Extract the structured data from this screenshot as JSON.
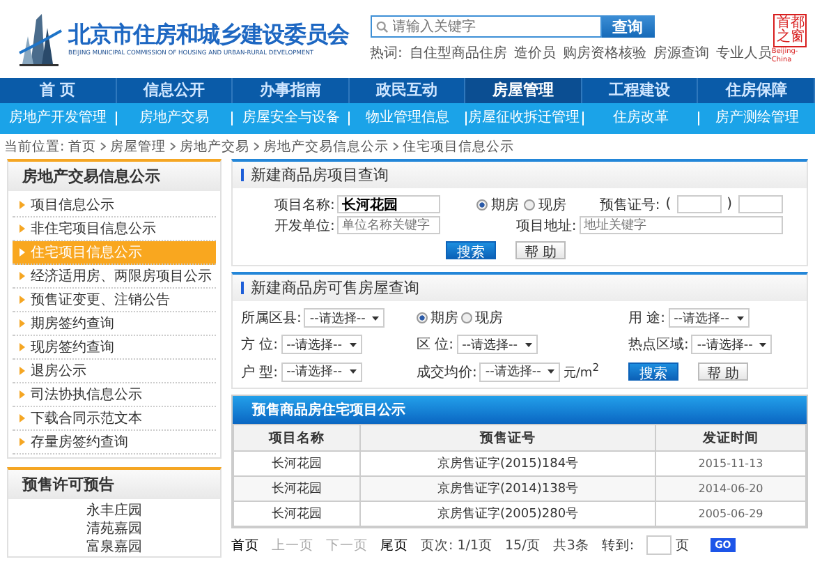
{
  "header": {
    "title": "北京市住房和城乡建设委员会",
    "subtitle": "BEIJING MUNICIPAL COMMISSION OF HOUSING AND URBAN-RURAL DEVELOPMENT",
    "search": {
      "placeholder": "请输入关键字"
    },
    "search_button": "查询",
    "hot_label": "热词:",
    "hot_words": [
      "自住型商品住房",
      "造价员",
      "购房资格核验",
      "房源查询",
      "专业人员"
    ],
    "seal": [
      "首都",
      "之窗"
    ],
    "seal_caption": "Beijing-China"
  },
  "nav": [
    {
      "label": "首 页",
      "selected": false
    },
    {
      "label": "信息公开",
      "selected": false
    },
    {
      "label": "办事指南",
      "selected": false
    },
    {
      "label": "政民互动",
      "selected": false
    },
    {
      "label": "房屋管理",
      "selected": true
    },
    {
      "label": "工程建设",
      "selected": false
    },
    {
      "label": "住房保障",
      "selected": false
    }
  ],
  "subnav": [
    "房地产开发管理",
    "房地产交易",
    "房屋安全与设备",
    "物业管理信息",
    "房屋征收拆迁管理",
    "住房改革",
    "房产测绘管理"
  ],
  "breadcrumb": {
    "label": "当前位置:",
    "items": [
      "首页",
      "房屋管理",
      "房地产交易",
      "房地产交易信息公示",
      "住宅项目信息公示"
    ]
  },
  "sidebar": {
    "title": "房地产交易信息公示",
    "items": [
      {
        "label": "项目信息公示",
        "selected": false
      },
      {
        "label": "非住宅项目信息公示",
        "selected": false
      },
      {
        "label": "住宅项目信息公示",
        "selected": true
      },
      {
        "label": "经济适用房、两限房项目公示",
        "selected": false
      },
      {
        "label": "预售证变更、注销公告",
        "selected": false
      },
      {
        "label": "期房签约查询",
        "selected": false
      },
      {
        "label": "现房签约查询",
        "selected": false
      },
      {
        "label": "退房公示",
        "selected": false
      },
      {
        "label": "司法协执信息公示",
        "selected": false
      },
      {
        "label": "下载合同示范文本",
        "selected": false
      },
      {
        "label": "存量房签约查询",
        "selected": false
      }
    ]
  },
  "presale": {
    "title": "预售许可预告",
    "items": [
      "永丰庄园",
      "清苑嘉园",
      "富泉嘉园"
    ]
  },
  "project_query": {
    "title": "新建商品房项目查询",
    "name_label": "项目名称:",
    "name_value": "长河花园",
    "radios": [
      {
        "label": "期房",
        "selected": true
      },
      {
        "label": "现房",
        "selected": false
      }
    ],
    "cert_label": "预售证号:",
    "cert_open": "(",
    "cert_close": ")",
    "developer_label": "开发单位:",
    "developer_placeholder": "单位名称关键字",
    "address_label": "项目地址:",
    "address_placeholder": "地址关键字",
    "buttons": [
      {
        "label": "搜索",
        "kind": "primary"
      },
      {
        "label": "帮 助",
        "kind": "secondary"
      }
    ]
  },
  "house_query": {
    "title": "新建商品房可售房屋查询",
    "fields": [
      {
        "kind": "select",
        "label": "所属区县:",
        "value": "--请选择--"
      },
      {
        "kind": "radios",
        "options": [
          {
            "label": "期房",
            "selected": true
          },
          {
            "label": "现房",
            "selected": false
          }
        ]
      },
      {
        "kind": "select",
        "label": "用 途:",
        "value": "--请选择--"
      },
      {
        "kind": "select",
        "label": "方 位:",
        "value": "--请选择--"
      },
      {
        "kind": "select",
        "label": "区 位:",
        "value": "--请选择--"
      },
      {
        "kind": "select",
        "label": "热点区域:",
        "value": "--请选择--"
      },
      {
        "kind": "select",
        "label": "户 型:",
        "value": "--请选择--"
      },
      {
        "kind": "select",
        "label": "成交均价:",
        "value": "--请选择--",
        "unit": "元/m$^{2}$"
      },
      {
        "kind": "buttons",
        "buttons": [
          {
            "label": "搜索",
            "kind": "primary"
          },
          {
            "label": "帮 助",
            "kind": "secondary"
          }
        ]
      }
    ]
  },
  "table": {
    "title": "预售商品房住宅项目公示",
    "columns": [
      "项目名称",
      "预售证号",
      "发证时间"
    ],
    "rows": [
      [
        "长河花园",
        "京房售证字(2015)184号",
        "2015-11-13"
      ],
      [
        "长河花园",
        "京房售证字(2014)138号",
        "2014-06-20"
      ],
      [
        "长河花园",
        "京房售证字(2005)280号",
        "2005-06-29"
      ]
    ]
  },
  "pagination": {
    "items": [
      {
        "label": "首页",
        "kind": "link"
      },
      {
        "label": "上一页",
        "kind": "disabled"
      },
      {
        "label": "下一页",
        "kind": "disabled"
      },
      {
        "label": "尾页",
        "kind": "link"
      },
      {
        "label": "页次: 1/1页",
        "kind": "text"
      },
      {
        "label": "15/页",
        "kind": "text"
      },
      {
        "label": "共3条",
        "kind": "text"
      }
    ],
    "goto_label": "转到:",
    "page_suffix": "页",
    "go_button": "GO"
  }
}
